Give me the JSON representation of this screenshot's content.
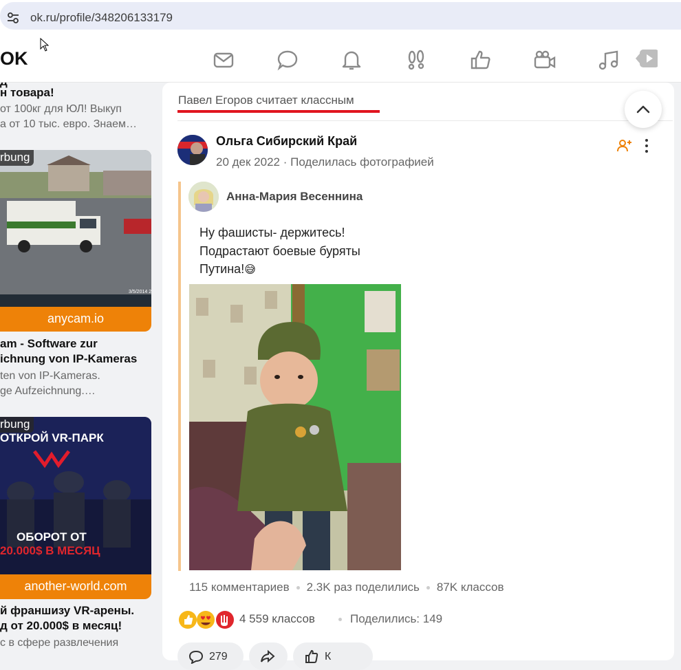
{
  "browser": {
    "url": "ok.ru/profile/348206133179"
  },
  "header": {
    "logo": "OK",
    "nav_icons": [
      "mail-icon",
      "chat-icon",
      "bell-icon",
      "guests-footprints-icon",
      "like-thumb-icon",
      "video-camera-icon",
      "music-note-icon",
      "play-video-icon"
    ]
  },
  "left_ads": {
    "ad1": {
      "title_line1": "д",
      "title_line2": "н товара!",
      "desc_line1": "от 100кг для ЮЛ! Выкуп",
      "desc_line2": "а от 10 тыс. евро. Знаем…"
    },
    "ad2": {
      "tag": "rbung",
      "url": "anycam.io",
      "title_line1": "am - Software zur",
      "title_line2": "ichnung von IP-Kameras",
      "desc_line1": "ten von IP-Kameras.",
      "desc_line2": "ge Aufzeichnung.…"
    },
    "ad3": {
      "tag": "rbung",
      "banner_top": "ОТКРОЙ VR-ПАРК",
      "banner_line1": "ОБОРОТ ОТ",
      "banner_line2": "20.000$ В МЕСЯЦ",
      "url": "another-world.com",
      "title_line1": "й франшизу VR-арены.",
      "title_line2": "д от 20.000$ в месяц!",
      "desc_line1": "с в сфере развлечения"
    }
  },
  "post": {
    "liked_by": "Павел Егоров считает классным",
    "author": "Ольга Сибирский Край",
    "date": "20 дек 2022",
    "action": "Поделилась фотографией",
    "repost": {
      "author": "Анна-Мария Весеннина",
      "text_line1": "Ну фашисты- держитесь!",
      "text_line2": "Подрастают боевые буряты",
      "text_line3": "Путина!",
      "emoji": "😅"
    },
    "photo_stats": {
      "comments": "115 комментариев",
      "shares": "2.3K раз поделились",
      "likes": "87K классов"
    },
    "post_stats": {
      "likes": "4 559 классов",
      "shared": "Поделились: 149"
    },
    "actions": {
      "comment_count": "279",
      "class_label": "К"
    }
  },
  "colors": {
    "accent_orange": "#ee8208",
    "accent_red": "#e0141f"
  }
}
